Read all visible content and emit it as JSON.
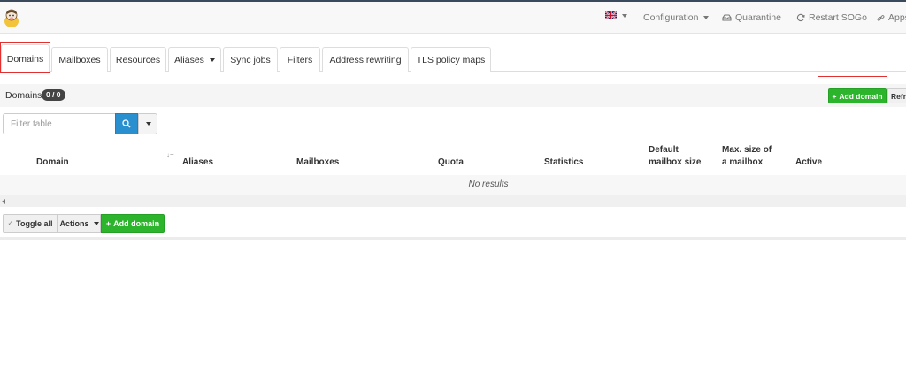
{
  "colors": {
    "accent_green": "#2cb52c",
    "search_blue": "#2a8fcf",
    "highlight_red": "#e03030",
    "badge_dark": "#444444"
  },
  "navbar": {
    "logo_icon": "cow-mascot-icon",
    "language_icon": "uk-flag-icon",
    "configuration": "Configuration",
    "quarantine": "Quarantine",
    "restart": "Restart SOGo",
    "apps": "Apps"
  },
  "tabs": [
    {
      "label": "Domains"
    },
    {
      "label": "Mailboxes"
    },
    {
      "label": "Resources"
    },
    {
      "label": "Aliases"
    },
    {
      "label": "Sync jobs"
    },
    {
      "label": "Filters"
    },
    {
      "label": "Address rewriting"
    },
    {
      "label": "TLS policy maps"
    }
  ],
  "panel": {
    "title": "Domains",
    "count": "0 / 0",
    "add_domain": "Add domain",
    "refresh": "Refresh"
  },
  "filter": {
    "placeholder": "Filter table"
  },
  "table": {
    "columns": {
      "domain": "Domain",
      "aliases": "Aliases",
      "mailboxes": "Mailboxes",
      "quota": "Quota",
      "statistics": "Statistics",
      "default_size_1": "Default",
      "default_size_2": "mailbox size",
      "max_size_1": "Max. size of",
      "max_size_2": "a mailbox",
      "active": "Active"
    },
    "empty_text": "No results"
  },
  "footer": {
    "toggle_all": "Toggle all",
    "actions": "Actions",
    "add_domain": "Add domain"
  }
}
